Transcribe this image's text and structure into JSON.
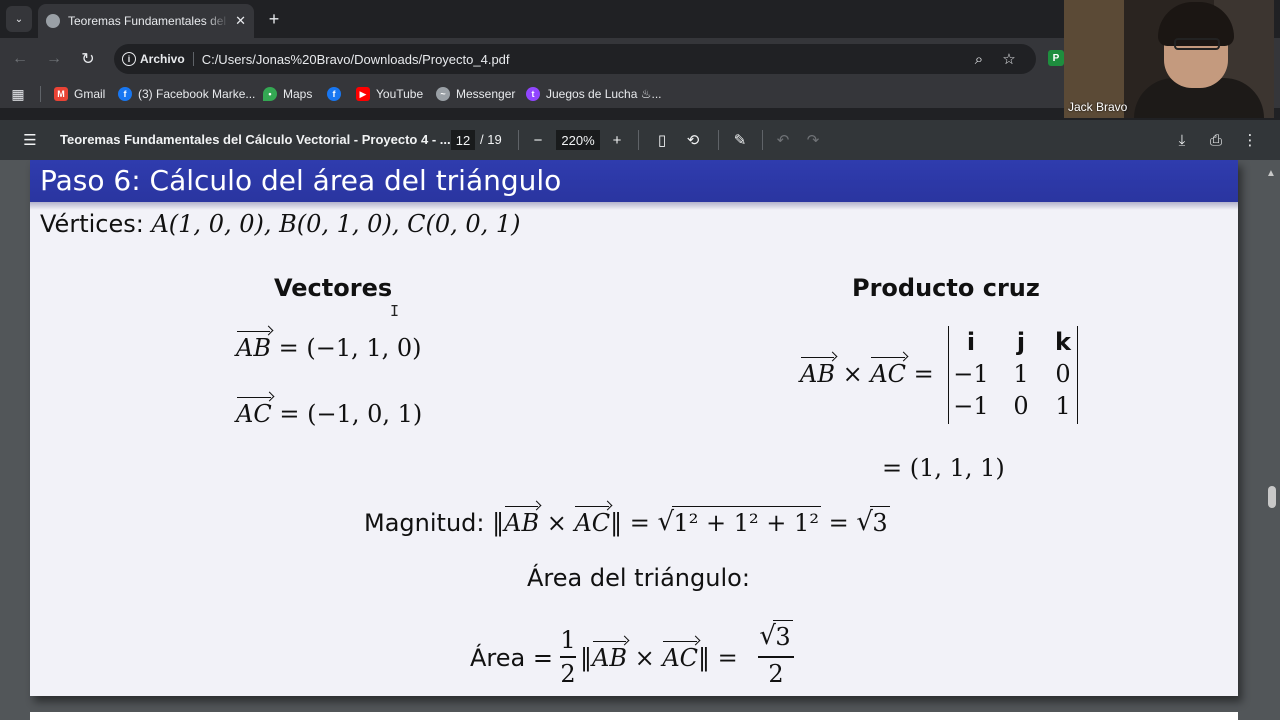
{
  "tab": {
    "title": "Teoremas Fundamentales del Cálculo Vectorial - Proyecto 4"
  },
  "toolbar": {
    "site_chip": "Archivo",
    "url": "C:/Users/Jonas%20Bravo/Downloads/Proyecto_4.pdf"
  },
  "bookmarks": [
    {
      "label": "Gmail",
      "icon": "gmail-icon",
      "color": "#ea4335"
    },
    {
      "label": "(3) Facebook Marke...",
      "icon": "facebook-icon",
      "color": "#1877f2"
    },
    {
      "label": "Maps",
      "icon": "maps-icon",
      "color": "#34a853"
    },
    {
      "label": "",
      "icon": "facebook-icon",
      "color": "#1877f2"
    },
    {
      "label": "YouTube",
      "icon": "youtube-icon",
      "color": "#ff0000"
    },
    {
      "label": "Messenger",
      "icon": "messenger-icon",
      "color": "#9aa0a6"
    },
    {
      "label": "Juegos de Lucha ♨...",
      "icon": "twitch-icon",
      "color": "#9146ff"
    }
  ],
  "pdf": {
    "title": "Teoremas Fundamentales del Cálculo Vectorial - Proyecto 4 - ...",
    "page": "12",
    "page_total": "/ 19",
    "zoom": "220%"
  },
  "webcam": {
    "name": "Jack Bravo"
  },
  "slide": {
    "title": "Paso 6: Cálculo del área del triángulo",
    "vertices_label": "Vértices:",
    "vertices": [
      "A(1, 0, 0),",
      "B(0, 1, 0),",
      "C(0, 0, 1)"
    ],
    "vectores_heading": "Vectores",
    "ab_value": "= (−1, 1, 0)",
    "ac_value": "= (−1, 0, 1)",
    "producto_heading": "Producto cruz",
    "matrix": [
      [
        "i",
        "j",
        "k"
      ],
      [
        "−1",
        "1",
        "0"
      ],
      [
        "−1",
        "0",
        "1"
      ]
    ],
    "cross_result": "= (1, 1, 1)",
    "magnitud_label": "Magnitud:",
    "magnitud_radicand": "1² + 1² + 1²",
    "magnitud_result": "3",
    "area_heading": "Área del triángulo:",
    "area_label": "Área =",
    "area_frac_num": "1",
    "area_frac_den": "2",
    "area_result_num": "3",
    "area_result_den": "2"
  }
}
